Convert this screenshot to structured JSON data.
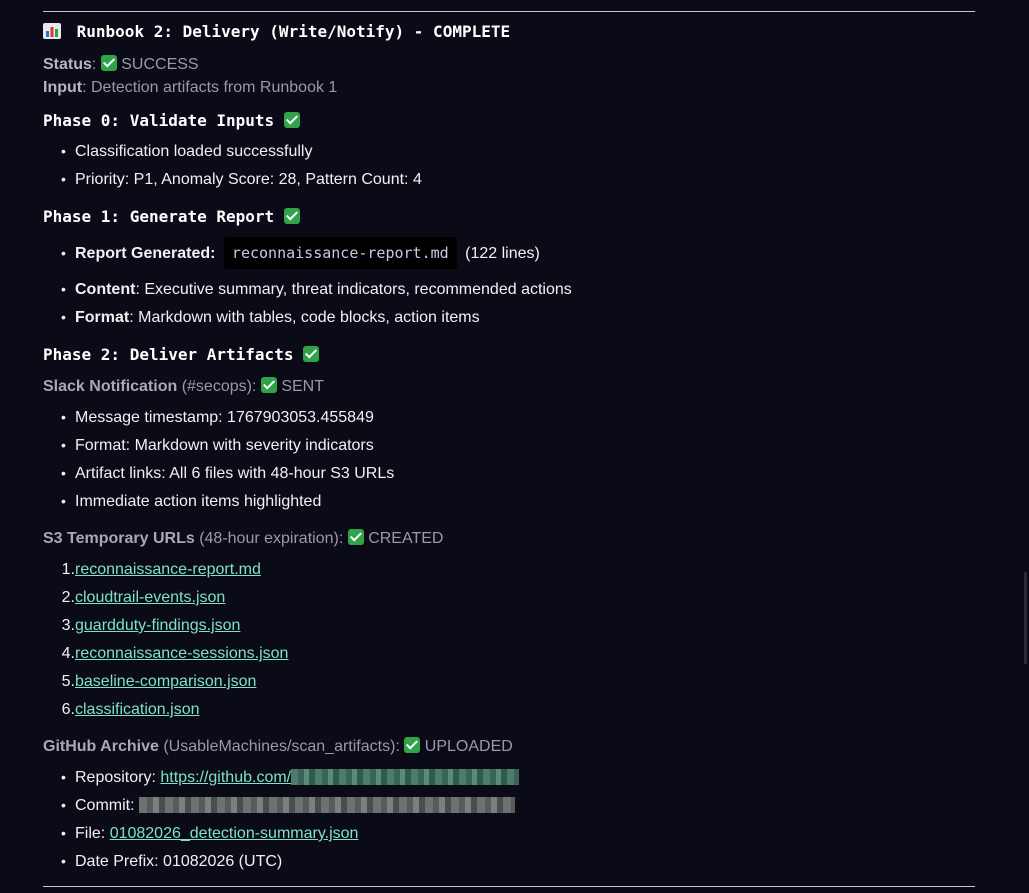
{
  "title": "Runbook 2: Delivery (Write/Notify) - COMPLETE",
  "status": {
    "label": "Status",
    "value": "SUCCESS"
  },
  "input": {
    "label": "Input",
    "value": "Detection artifacts from Runbook 1"
  },
  "phase0": {
    "heading": "Phase 0: Validate Inputs",
    "items": [
      "Classification loaded successfully",
      "Priority: P1, Anomaly Score: 28, Pattern Count: 4"
    ]
  },
  "phase1": {
    "heading": "Phase 1: Generate Report",
    "items": [
      {
        "label": "Report Generated",
        "code": "reconnaissance-report.md",
        "rest": "(122 lines)"
      },
      {
        "label": "Content",
        "rest": ": Executive summary, threat indicators, recommended actions"
      },
      {
        "label": "Format",
        "rest": ": Markdown with tables, code blocks, action items"
      }
    ]
  },
  "phase2": {
    "heading": "Phase 2: Deliver Artifacts",
    "slack": {
      "label": "Slack Notification",
      "detail": "(#secops):",
      "status": "SENT",
      "items": [
        "Message timestamp: 1767903053.455849",
        "Format: Markdown with severity indicators",
        "Artifact links: All 6 files with 48-hour S3 URLs",
        "Immediate action items highlighted"
      ]
    },
    "s3": {
      "label": "S3 Temporary URLs",
      "detail": "(48-hour expiration):",
      "status": "CREATED",
      "files": [
        "reconnaissance-report.md",
        "cloudtrail-events.json",
        "guardduty-findings.json",
        "reconnaissance-sessions.json",
        "baseline-comparison.json",
        "classification.json"
      ]
    },
    "github": {
      "label": "GitHub Archive",
      "detail": "(UsableMachines/scan_artifacts):",
      "status": "UPLOADED",
      "repository_label": "Repository:",
      "repository_url": "https://github.com/",
      "commit_label": "Commit:",
      "file_label": "File:",
      "file_value": "01082026_detection-summary.json",
      "date_label": "Date Prefix:",
      "date_value": "01082026 (UTC)"
    }
  },
  "colors": {
    "background": "#0b0b17",
    "link": "#7fe3c3",
    "check": "#2fa24a"
  },
  "icons": {
    "title": "bar-chart-icon",
    "check": "check-mark-icon"
  }
}
